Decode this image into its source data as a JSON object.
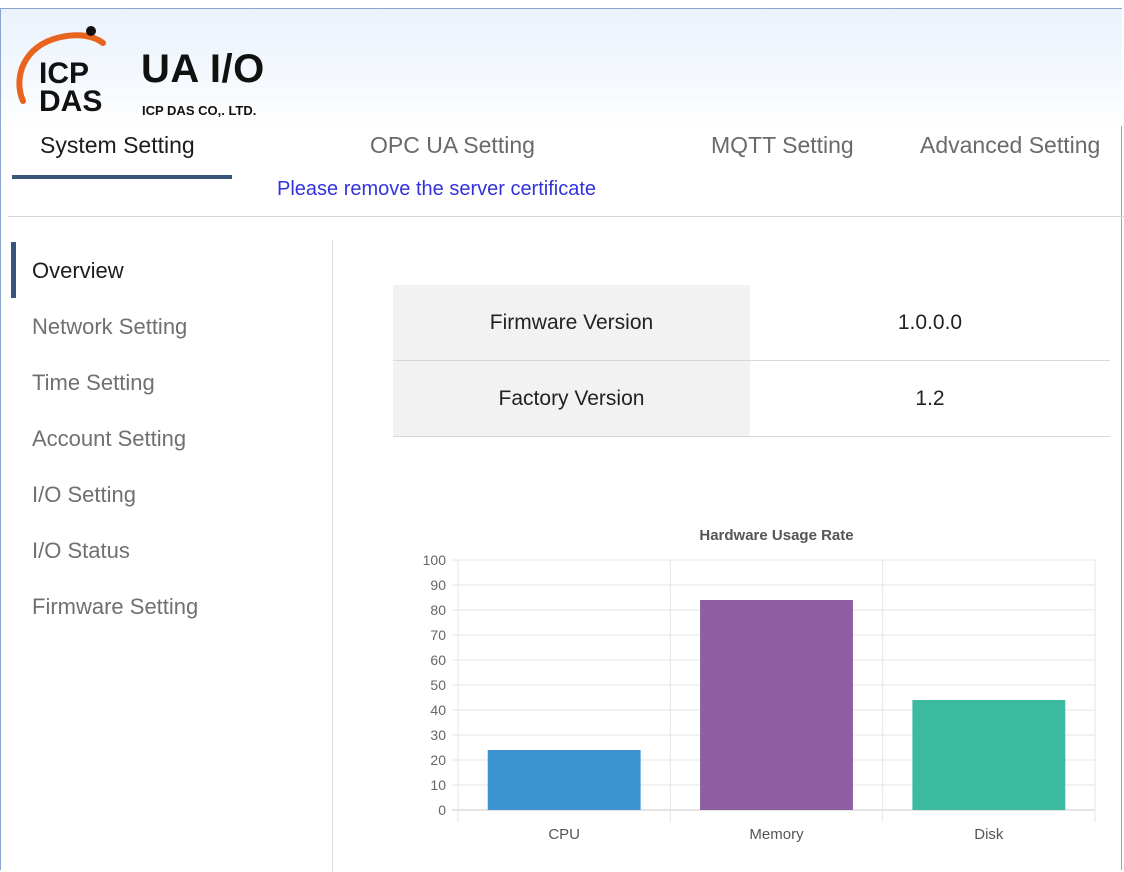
{
  "brand": {
    "logo_text_top": "ICP",
    "logo_text_bottom": "DAS",
    "title": "UA I/O",
    "subtitle": "ICP DAS CO,. LTD."
  },
  "tabs": [
    {
      "label": "System Setting",
      "active": true
    },
    {
      "label": "OPC UA Setting",
      "active": false
    },
    {
      "label": "MQTT Setting",
      "active": false
    },
    {
      "label": "Advanced Setting",
      "active": false
    }
  ],
  "notice": "Please remove the server certificate",
  "sidebar": {
    "items": [
      {
        "label": "Overview",
        "active": true
      },
      {
        "label": "Network Setting",
        "active": false
      },
      {
        "label": "Time Setting",
        "active": false
      },
      {
        "label": "Account Setting",
        "active": false
      },
      {
        "label": "I/O Setting",
        "active": false
      },
      {
        "label": "I/O Status",
        "active": false
      },
      {
        "label": "Firmware Setting",
        "active": false
      }
    ]
  },
  "info": {
    "rows": [
      {
        "label": "Firmware Version",
        "value": "1.0.0.0"
      },
      {
        "label": "Factory Version",
        "value": "1.2"
      }
    ]
  },
  "colors": {
    "accent": "#39557a",
    "notice": "#3333dd",
    "logo_orange": "#e8641e",
    "cpu": "#3d93d0",
    "memory": "#8e5ea2",
    "disk": "#3cba9f"
  },
  "chart_data": {
    "type": "bar",
    "title": "Hardware Usage Rate",
    "categories": [
      "CPU",
      "Memory",
      "Disk"
    ],
    "values": [
      24,
      84,
      44
    ],
    "bar_colors": [
      "#3d93d0",
      "#8e5ea2",
      "#3cba9f"
    ],
    "ylim": [
      0,
      100
    ],
    "yticks": [
      "0",
      "10",
      "20",
      "30",
      "40",
      "50",
      "60",
      "70",
      "80",
      "90",
      "100"
    ],
    "grid": true,
    "legend": "none"
  }
}
